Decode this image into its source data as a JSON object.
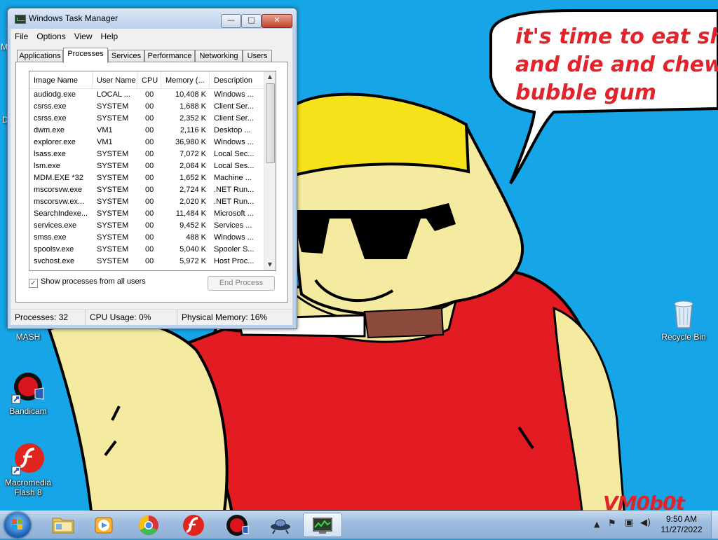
{
  "desktop": {
    "speech_lines": [
      "it's time to eat shit",
      "and die and chew",
      "bubble gum"
    ],
    "signature": "VM0b0t",
    "partial_labels": [
      "M",
      "D"
    ],
    "icons": [
      {
        "name": "MASH",
        "icon": "mash-icon"
      },
      {
        "name": "Recycle Bin",
        "icon": "recycle-bin-icon"
      },
      {
        "name": "Bandicam",
        "icon": "bandicam-icon"
      },
      {
        "name": "Macromedia Flash 8",
        "icon": "flash-icon"
      }
    ]
  },
  "task_manager": {
    "title": "Windows Task Manager",
    "window_buttons": {
      "minimize": "—",
      "maximize": "□",
      "close": "✕"
    },
    "menu": [
      "File",
      "Options",
      "View",
      "Help"
    ],
    "tabs": [
      "Applications",
      "Processes",
      "Services",
      "Performance",
      "Networking",
      "Users"
    ],
    "active_tab": "Processes",
    "columns": [
      "Image Name",
      "User Name",
      "CPU",
      "Memory (...",
      "Description"
    ],
    "sort_column": "Image Name",
    "rows": [
      [
        "audiodg.exe",
        "LOCAL ...",
        "00",
        "10,408 K",
        "Windows ..."
      ],
      [
        "csrss.exe",
        "SYSTEM",
        "00",
        "1,688 K",
        "Client Ser..."
      ],
      [
        "csrss.exe",
        "SYSTEM",
        "00",
        "2,352 K",
        "Client Ser..."
      ],
      [
        "dwm.exe",
        "VM1",
        "00",
        "2,116 K",
        "Desktop ..."
      ],
      [
        "explorer.exe",
        "VM1",
        "00",
        "36,980 K",
        "Windows ..."
      ],
      [
        "lsass.exe",
        "SYSTEM",
        "00",
        "7,072 K",
        "Local Sec..."
      ],
      [
        "lsm.exe",
        "SYSTEM",
        "00",
        "2,064 K",
        "Local Ses..."
      ],
      [
        "MDM.EXE *32",
        "SYSTEM",
        "00",
        "1,652 K",
        "Machine ..."
      ],
      [
        "mscorsvw.exe",
        "SYSTEM",
        "00",
        "2,724 K",
        ".NET Run..."
      ],
      [
        "mscorsvw.ex...",
        "SYSTEM",
        "00",
        "2,020 K",
        ".NET Run..."
      ],
      [
        "SearchIndexe...",
        "SYSTEM",
        "00",
        "11,484 K",
        "Microsoft ..."
      ],
      [
        "services.exe",
        "SYSTEM",
        "00",
        "9,452 K",
        "Services ..."
      ],
      [
        "smss.exe",
        "SYSTEM",
        "00",
        "488 K",
        "Windows ..."
      ],
      [
        "spoolsv.exe",
        "SYSTEM",
        "00",
        "5,040 K",
        "Spooler S..."
      ],
      [
        "svchost.exe",
        "SYSTEM",
        "00",
        "5,972 K",
        "Host Proc..."
      ]
    ],
    "show_all_label": "Show processes from all users",
    "show_all_checked": true,
    "end_process_label": "End Process",
    "status": {
      "processes": "Processes: 32",
      "cpu": "CPU Usage: 0%",
      "memory": "Physical Memory: 16%"
    }
  },
  "taskbar": {
    "apps": [
      {
        "name": "Windows Explorer",
        "icon": "folder-icon"
      },
      {
        "name": "Windows Media Player",
        "icon": "media-player-icon"
      },
      {
        "name": "Google Chrome",
        "icon": "chrome-icon"
      },
      {
        "name": "Macromedia Flash",
        "icon": "flash-icon"
      },
      {
        "name": "Bandicam",
        "icon": "bandicam-icon"
      },
      {
        "name": "Mouse Sonic app",
        "icon": "ufo-icon"
      },
      {
        "name": "Windows Task Manager",
        "icon": "task-manager-icon",
        "active": true
      }
    ],
    "clock": {
      "time": "9:50 AM",
      "date": "11/27/2022"
    }
  }
}
